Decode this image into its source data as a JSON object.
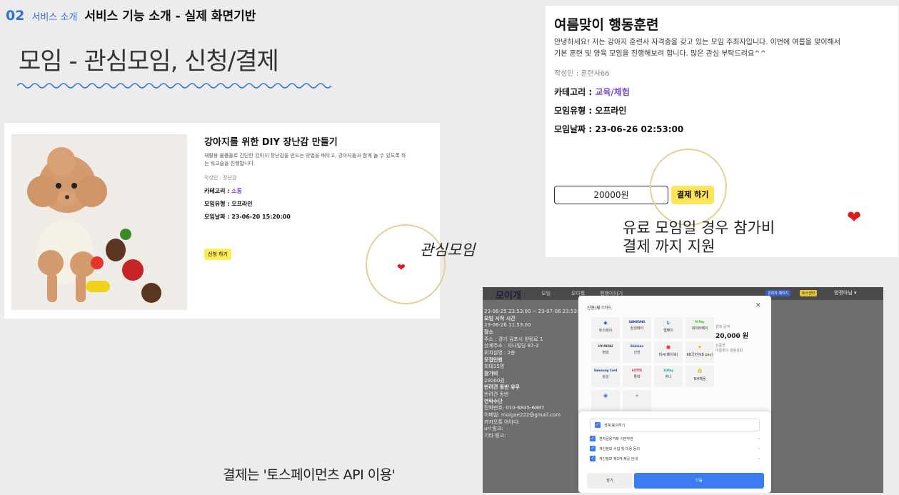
{
  "header": {
    "number": "02",
    "section": "서비스 소개",
    "title": "서비스 기능 소개 - 실제 화면기반"
  },
  "main_title": "모임 - 관심모임, 신청/결제",
  "card1": {
    "title": "강아지를 위한 DIY 장난감 만들기",
    "desc_line1": "재활용 물품들로 간단한 강아지 장난감을 만드는 방법을 배우고, 강아지들과 함께 놀 수 있도록 하",
    "desc_line2": "는 워크숍을 진행합니다.",
    "author": "작성인 : 장난감",
    "category_label": "카테고리 : ",
    "category_value": "소통",
    "type": "모임유형 : 오프라인",
    "date": "모임날짜 : 23-06-20 15:20:00",
    "button": "신청 하기"
  },
  "label_interest": "관심모임",
  "card2": {
    "title": "여름맞이 행동훈련",
    "desc_line1": "안녕하세요! 저는 강아지 훈련사 자격증을 갖고 있는 모임 주최자입니다. 이번에 여름을 맞이해서",
    "desc_line2": "기본 훈련 및 양육 모임을 진행해보려 합니다. 많은 관심 부탁드려요^^",
    "author": "작성인 : 훈련사66",
    "category_label": "카테고리 : ",
    "category_value": "교육/체험",
    "type": "모임유형 : 오프라인",
    "date": "모임날짜 : 23-06-26 02:53:00",
    "amount": "20000원",
    "pay_button": "결제 하기"
  },
  "note_line1": "유료 모임일 경우 참가비",
  "note_line2": "결제 까지 지원",
  "screenshot": {
    "logo": "모이개",
    "nav": [
      "모임",
      "모이톡",
      "챙챙이야기"
    ],
    "chip1": "관리자 페이지",
    "chip2": "토스센터",
    "user": "양정아님 ▾",
    "left": [
      {
        "t": "23-06-25 23:53:00 ~ 23-07-06 23:53:00",
        "b": false
      },
      {
        "t": "모임 시작 시간",
        "b": true
      },
      {
        "t": "23-06-26 11:53:00",
        "b": false
      },
      {
        "t": "장소",
        "b": true
      },
      {
        "t": "주소 : 경기 김포시 양림로 1",
        "b": false
      },
      {
        "t": "상세주소 : 지나빌딩 87-3",
        "b": false
      },
      {
        "t": "위치설명 : 2층",
        "b": false
      },
      {
        "t": "모집인원",
        "b": true
      },
      {
        "t": "최대15명",
        "b": false
      },
      {
        "t": "참가비",
        "b": true
      },
      {
        "t": "20000원",
        "b": false
      },
      {
        "t": "반려견 동반 유무",
        "b": true
      },
      {
        "t": "반려견 동반",
        "b": false
      },
      {
        "t": "연락수단",
        "b": true
      },
      {
        "t": "전화번호: 010-6845-6887",
        "b": false
      },
      {
        "t": "이메일: moigae222@gmail.com",
        "b": false
      },
      {
        "t": "카카오톡 아이디:",
        "b": false
      },
      {
        "t": "url 링크:",
        "b": false
      },
      {
        "t": "기타 링크:",
        "b": false
      }
    ],
    "modal": {
      "title": "신용/체크카드",
      "close": "✕",
      "pays": [
        {
          "icon": "◆",
          "name": "토스페이",
          "color": "#2f6fd6"
        },
        {
          "icon": "SAMSUNG",
          "name": "삼성페이",
          "color": "#1a3a8f"
        },
        {
          "icon": "L",
          "name": "엘페이",
          "color": "#2e6bd8"
        },
        {
          "icon": "N Pay",
          "name": "네이버페이",
          "color": "#1ec800"
        },
        {
          "icon": "HYUNDAI",
          "name": "현대",
          "color": "#444"
        },
        {
          "icon": "Shinhan",
          "name": "신한",
          "color": "#1a3a8f"
        },
        {
          "icon": "●",
          "name": "비씨(페이북)",
          "color": "#e8432e"
        },
        {
          "icon": "★",
          "name": "KB국민(KB pay)",
          "color": "#f2b705"
        },
        {
          "icon": "Samsung Card",
          "name": "삼성",
          "color": "#1a3a8f"
        },
        {
          "icon": "LOTTE",
          "name": "롯데",
          "color": "#d8152a"
        },
        {
          "icon": "1QPay",
          "name": "하나",
          "color": "#00a99d"
        },
        {
          "icon": "Ö",
          "name": "NH채움",
          "color": "#f2a900"
        },
        {
          "icon": "◉",
          "name": "",
          "color": "#2f6fd6"
        },
        {
          "icon": "+",
          "name": "",
          "color": "#999"
        }
      ],
      "side_label": "결제 금액",
      "price": "20,000 원",
      "side_label2": "상품명",
      "product": "여름맞이 행동훈련",
      "agree_all": "전체 동의하기",
      "agree_items": [
        "전자금융거래 기본약관",
        "개인정보 수집 및 이용 동의",
        "개인정보 제3자 제공 안내"
      ],
      "close_button": "닫기",
      "next_button": "다음"
    }
  },
  "label_toss": "결제는 '토스페이먼츠 API 이용'"
}
